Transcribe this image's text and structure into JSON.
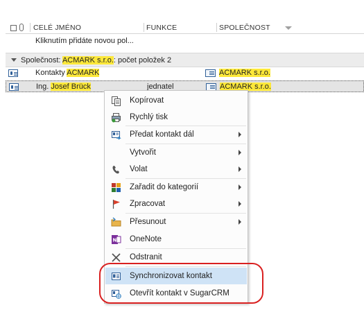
{
  "header": {
    "columns": [
      "CELÉ JMÉNO",
      "FUNKCE",
      "SPOLEČNOST"
    ],
    "icons": [
      "contact-icon",
      "attachment-icon"
    ]
  },
  "new_row_hint": "Kliknutím přidáte novou pol...",
  "group": {
    "prefix": "Společnost: ",
    "value": "ACMARK s.r.o.",
    "suffix": ": počet položek 2"
  },
  "rows": [
    {
      "name_prefix": "Kontakty ",
      "name_hl": "ACMARK",
      "function": "",
      "company": "ACMARK s.r.o."
    },
    {
      "name_prefix": "Ing. ",
      "name_hl": "Josef Brück",
      "function": "jednatel",
      "company": "ACMARK s.r.o."
    }
  ],
  "context_menu": {
    "items": [
      {
        "label": "Kopírovat",
        "icon": "copy-icon",
        "submenu": false
      },
      {
        "label": "Rychlý tisk",
        "icon": "quick-print-icon",
        "submenu": false
      },
      {
        "label": "Předat kontakt dál",
        "icon": "forward-contact-icon",
        "submenu": true
      },
      {
        "label": "Vytvořit",
        "icon": "",
        "submenu": true
      },
      {
        "label": "Volat",
        "icon": "phone-icon",
        "submenu": true
      },
      {
        "label": "Zařadit do kategorií",
        "icon": "categorize-icon",
        "submenu": true
      },
      {
        "label": "Zpracovat",
        "icon": "flag-icon",
        "submenu": true
      },
      {
        "label": "Přesunout",
        "icon": "move-folder-icon",
        "submenu": true
      },
      {
        "label": "OneNote",
        "icon": "onenote-icon",
        "submenu": false
      },
      {
        "label": "Odstranit",
        "icon": "delete-icon",
        "submenu": false
      },
      {
        "label": "Synchronizovat kontakt",
        "icon": "sync-contact-icon",
        "submenu": false,
        "highlighted": true
      },
      {
        "label": "Otevřít kontakt v SugarCRM",
        "icon": "open-crm-icon",
        "submenu": false
      }
    ]
  },
  "colors": {
    "highlight": "#fde83a",
    "menu_hover": "#cfe3f6",
    "annotation_circle": "#d92020"
  }
}
